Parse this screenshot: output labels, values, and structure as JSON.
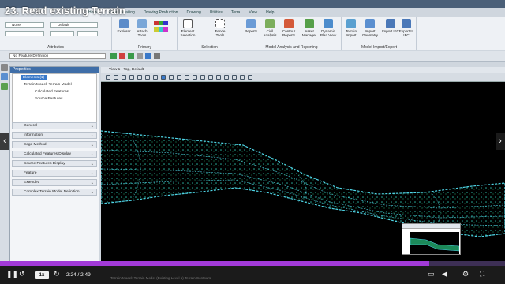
{
  "lesson": {
    "title": "23. Read existing Terrain"
  },
  "menu": {
    "tabs": [
      "Home",
      "Model Detailing",
      "Drawing Production",
      "Drawing",
      "Utilities",
      "Terra",
      "View",
      "Help"
    ],
    "active": 0
  },
  "ribbon": {
    "attributes_label": "Attributes",
    "primary_label": "Primary",
    "selection_label": "Selection",
    "analysis_label": "Model Analysis and Reporting",
    "import_label": "Model Import/Export",
    "level_value": "None",
    "style_value": "Default",
    "buttons": {
      "explorer": "Explorer",
      "attach_tools": "Attach Tools",
      "element_selection": "Element Selection",
      "fence_tools": "Fence Tools",
      "reports": "Reports",
      "civil_analysis": "Civil Analysis",
      "contour_reports": "Contour Reports",
      "asset_manager": "Asset Manager",
      "dynamic_plan_view": "Dynamic Plan View",
      "terrain_import": "Terrain Import",
      "import_geometry": "Import Geometry",
      "import_ifc": "Import IFC",
      "export_to_ifc": "Export to IFC"
    }
  },
  "feature_definition": {
    "value": "No Feature Definition"
  },
  "properties": {
    "title": "Properties",
    "tree": [
      "Elements (1)",
      "Terrain Model: Terrain Model",
      "Calculated Features",
      "Source Features"
    ],
    "sections": [
      "General",
      "Information",
      "Edge Method",
      "Calculated Features Display",
      "Source Features Display",
      "Feature",
      "Extended",
      "Complex Terrain Model Definition"
    ]
  },
  "view": {
    "title": "View 1 - Top, Default"
  },
  "player": {
    "progress": 0.85,
    "speed": "1x",
    "time": "2:24 / 2:49",
    "status": "Terrain Model: Terrain Model (Existing Level 1) Terrain Contours"
  },
  "colors": {
    "accent": "#a23ad8",
    "terrain_edge": "#4fd4e6",
    "terrain_fill": "#1c8a5a",
    "selection": "#3a79c9"
  },
  "icons": [
    "back-icon",
    "replay-icon",
    "forward-icon",
    "volume-icon",
    "notes-icon",
    "settings-icon",
    "fullscreen-icon",
    "chevron-left-icon",
    "chevron-right-icon"
  ]
}
